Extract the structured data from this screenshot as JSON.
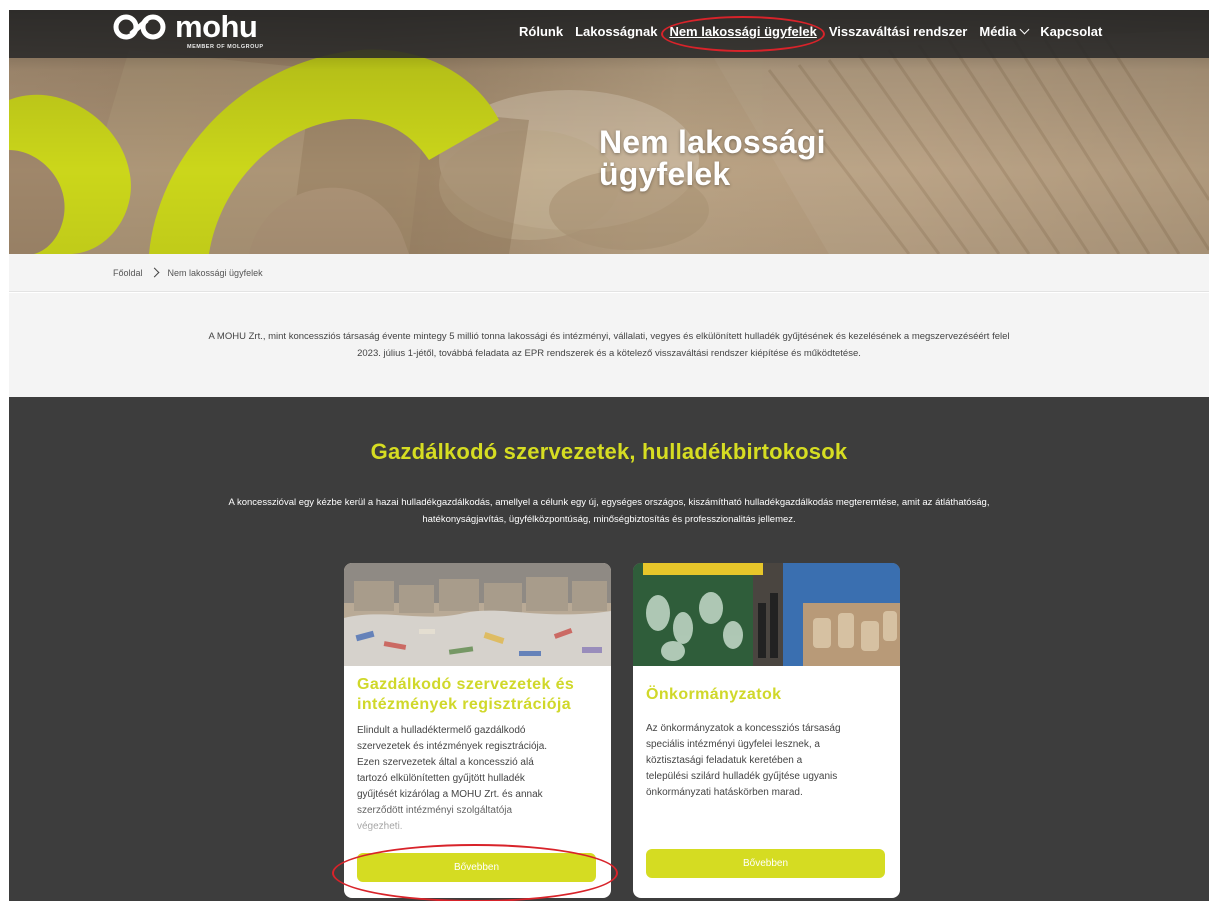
{
  "header": {
    "logo_text": "mohu",
    "logo_subtitle": "MEMBER OF MOLGROUP",
    "nav": [
      {
        "label": "Rólunk"
      },
      {
        "label": "Lakosságnak"
      },
      {
        "label": "Nem lakossági ügyfelek",
        "active": true
      },
      {
        "label": "Visszaváltási rendszer"
      },
      {
        "label": "Média",
        "has_dropdown": true
      },
      {
        "label": "Kapcsolat"
      }
    ]
  },
  "hero": {
    "title_line1": "Nem lakossági",
    "title_line2": "ügyfelek"
  },
  "breadcrumb": {
    "home": "Főoldal",
    "current": "Nem lakossági ügyfelek"
  },
  "intro": {
    "line1": "A MOHU Zrt., mint koncessziós társaság évente mintegy 5 millió tonna lakossági és intézményi, vállalati, vegyes és elkülönített hulladék gyűjtésének és kezelésének a megszervezéséért felel",
    "line2": "2023. július 1-jétől, továbbá feladata az EPR rendszerek és a kötelező visszaváltási rendszer kiépítése és működtetése."
  },
  "section": {
    "title": "Gazdálkodó szervezetek, hulladékbirtokosok",
    "text_line1": "A koncesszióval egy kézbe kerül a hazai hulladékgazdálkodás, amellyel a célunk egy új, egységes országos, kiszámítható hulladékgazdálkodás megteremtése, amit az  átláthatóság,",
    "text_line2": "hatékonyságjavítás, ügyfélközpontúság, minőségbiztosítás és professzionalitás jellemez."
  },
  "cards": [
    {
      "title_line1": "Gazdálkodó szervezetek és",
      "title_line2": "intézmények regisztrációja",
      "body_lines": [
        "Elindult a hulladéktermelő gazdálkodó",
        "szervezetek és intézmények regisztrációja.",
        "Ezen szervezetek által a koncesszió alá",
        "tartozó elkülönítetten gyűjtött hulladék",
        "gyűjtését kizárólag a MOHU Zrt. és annak",
        "szerződött intézményi szolgáltatója",
        "végezheti."
      ],
      "button": "Bővebben"
    },
    {
      "title_line1": "Önkormányzatok",
      "body_lines": [
        "Az önkormányzatok a koncessziós társaság",
        "speciális intézményi ügyfelei lesznek, a",
        "köztisztasági feladatuk keretében a",
        "települési szilárd hulladék gyűjtése ugyanis",
        "önkormányzati hatáskörben marad."
      ],
      "button": "Bővebben"
    }
  ],
  "colors": {
    "accent": "#d6dd22",
    "dark_bg": "#3d3d3d",
    "annotation": "#d8232a"
  }
}
